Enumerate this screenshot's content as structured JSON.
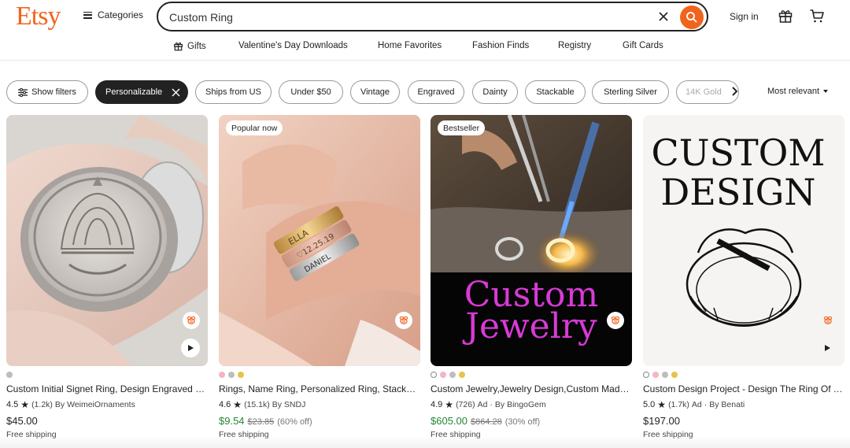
{
  "header": {
    "logo": "Etsy",
    "categories_label": "Categories",
    "search_value": "Custom Ring",
    "signin_label": "Sign in",
    "brand_color": "#f1641e"
  },
  "nav": {
    "items": [
      "Gifts",
      "Valentine's Day Downloads",
      "Home Favorites",
      "Fashion Finds",
      "Registry",
      "Gift Cards"
    ]
  },
  "filters": {
    "show_filters": "Show filters",
    "chips": [
      "Personalizable",
      "Ships from US",
      "Under $50",
      "Vintage",
      "Engraved",
      "Dainty",
      "Stackable",
      "Sterling Silver",
      "14K Gold"
    ],
    "active_chip": "Personalizable",
    "sort_label": "Most relevant"
  },
  "listings": [
    {
      "badge": "",
      "title": "Custom Initial Signet Ring, Design Engraved Ring, Personalized Family Crest",
      "rating": "4.5",
      "reviews": "(1.2k)",
      "ad": "",
      "seller": "By WeimeiOrnaments",
      "price": "$45.00",
      "original_price": "",
      "discount": "",
      "shipping": "Free shipping",
      "swatches": [
        "#bdbdbd"
      ],
      "has_video": true
    },
    {
      "badge": "Popular now",
      "title": "Rings, Name Ring, Personalized Ring, Stackable Name Ring",
      "rating": "4.6",
      "reviews": "(15.1k)",
      "ad": "",
      "seller": "By SNDJ",
      "price": "$9.54",
      "original_price": "$23.85",
      "discount": "(60% off)",
      "shipping": "Free shipping",
      "swatches": [
        "#f4b6c2",
        "#bdbdbd",
        "#e5c44b"
      ],
      "has_video": false
    },
    {
      "badge": "Bestseller",
      "title": "Custom Jewelry,Jewelry Design,Custom Made Ring",
      "rating": "4.9",
      "reviews": "(726)",
      "ad": "Ad",
      "seller": "By BingoGem",
      "price": "$605.00",
      "original_price": "$864.28",
      "discount": "(30% off)",
      "shipping": "Free shipping",
      "swatches": [
        "#ffffff",
        "#f4b6c2",
        "#bdbdbd",
        "#e5c44b"
      ],
      "has_video": false,
      "image_text": [
        "Custom",
        "Jewelry"
      ]
    },
    {
      "badge": "",
      "title": "Custom Design Project - Design The Ring Of Your Dreams",
      "rating": "5.0",
      "reviews": "(1.7k)",
      "ad": "Ad",
      "seller": "By Benati",
      "price": "$197.00",
      "original_price": "",
      "discount": "",
      "shipping": "Free shipping",
      "swatches": [
        "#ffffff",
        "#f4b6c2",
        "#bdbdbd",
        "#e5c44b"
      ],
      "has_video": true,
      "image_text": [
        "CUSTOM",
        "DESIGN"
      ]
    }
  ]
}
